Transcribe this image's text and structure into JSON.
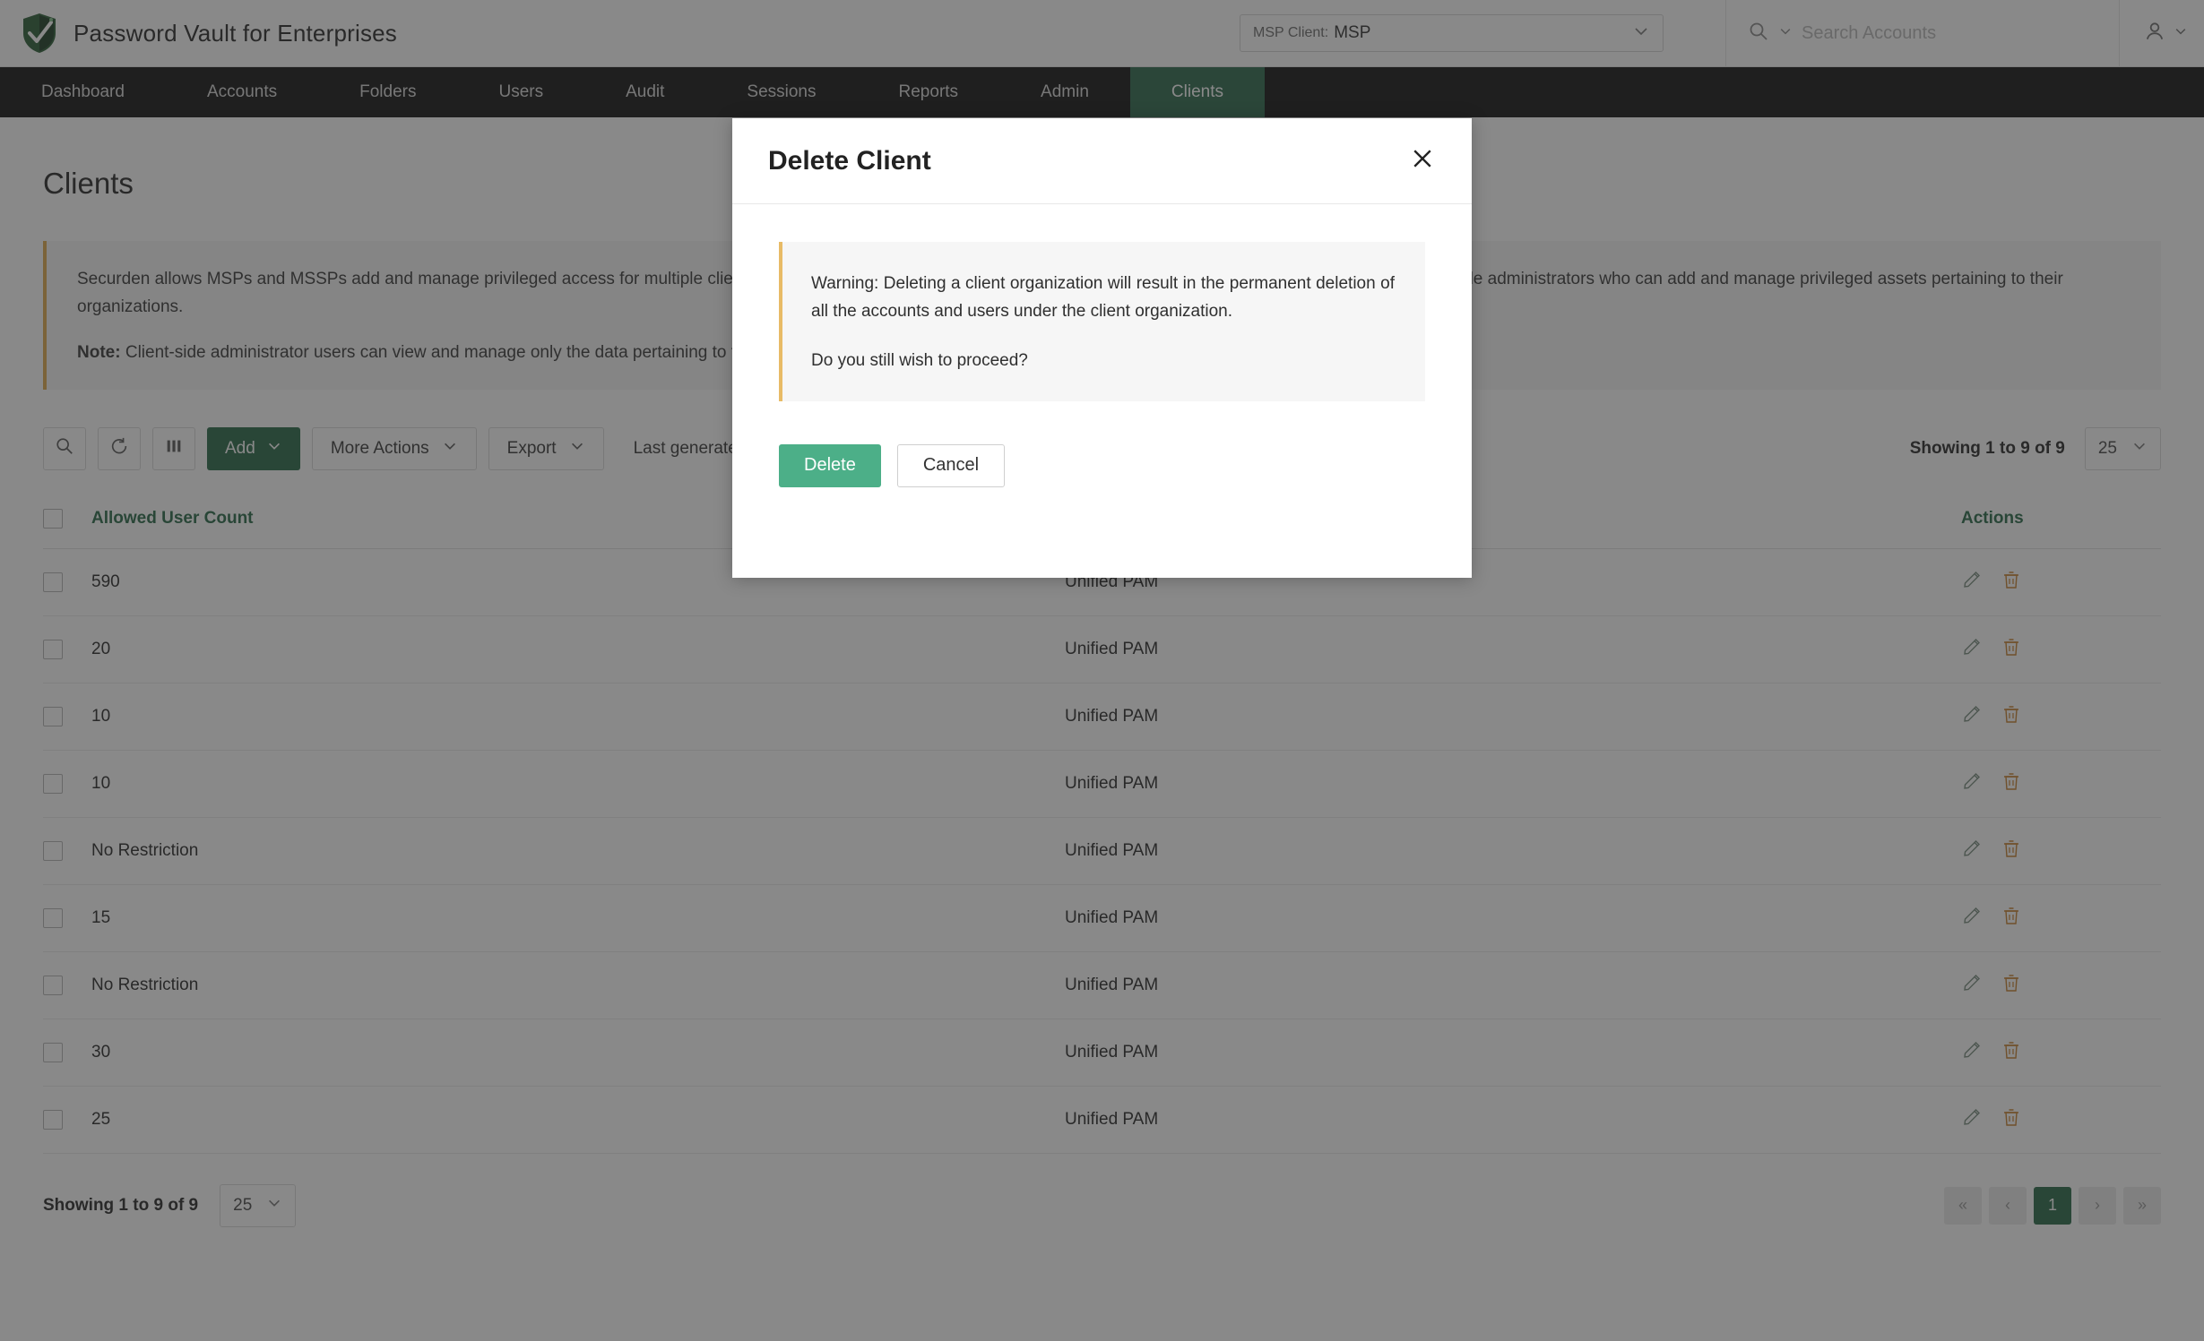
{
  "header": {
    "brand_title": "Password Vault for Enterprises",
    "logo_icon": "shield-check-icon",
    "msp_client_label": "MSP Client:",
    "msp_client_value": "MSP",
    "msp_chevron_icon": "chevron-down-icon",
    "search_icon": "search-icon",
    "search_chevron_icon": "chevron-down-icon",
    "search_placeholder": "Search Accounts",
    "search_value": "",
    "user_icon": "user-icon",
    "user_chevron_icon": "chevron-down-icon"
  },
  "nav": {
    "items": [
      {
        "label": "Dashboard",
        "active": false
      },
      {
        "label": "Accounts",
        "active": false
      },
      {
        "label": "Folders",
        "active": false
      },
      {
        "label": "Users",
        "active": false
      },
      {
        "label": "Audit",
        "active": false
      },
      {
        "label": "Sessions",
        "active": false
      },
      {
        "label": "Reports",
        "active": false
      },
      {
        "label": "Admin",
        "active": false
      },
      {
        "label": "Clients",
        "active": true
      }
    ],
    "active_accent": "#2f6b4f"
  },
  "page": {
    "title": "Clients",
    "info_banner": {
      "paragraph": "Securden allows MSPs and MSSPs add and manage privileged access for multiple clients. You can fully control client privileged access, or opt a co-managed model and assign client-side administrators who can add and manage privileged assets pertaining to their organizations.",
      "note_label": "Note:",
      "note_text": " Client-side administrator users can view and manage only the data pertaining to their own organizations.",
      "accent_color": "#e0aa4f"
    }
  },
  "toolbar": {
    "search_icon": "search-icon",
    "refresh_icon": "refresh-icon",
    "columns_icon": "columns-icon",
    "add_label": "Add",
    "add_chevron_icon": "chevron-down-icon",
    "more_actions_label": "More Actions",
    "more_actions_chevron_icon": "chevron-down-icon",
    "export_label": "Export",
    "export_chevron_icon": "chevron-down-icon",
    "last_generated_text": "Last generated o",
    "showing_text": "Showing 1 to 9 of 9",
    "page_size_value": "25",
    "page_size_chevron_icon": "chevron-down-icon",
    "add_color": "#2b6b4b"
  },
  "table": {
    "columns": {
      "select_all": "select-all-checkbox",
      "allowed_user_count": "Allowed User Count",
      "client_type": "",
      "actions": "Actions"
    },
    "header_color": "#2b6b4b",
    "rows": [
      {
        "allowed_user_count": "590",
        "client_type": "Unified PAM",
        "edit_icon": "pencil-icon",
        "delete_icon": "trash-icon"
      },
      {
        "allowed_user_count": "20",
        "client_type": "Unified PAM",
        "edit_icon": "pencil-icon",
        "delete_icon": "trash-icon"
      },
      {
        "allowed_user_count": "10",
        "client_type": "Unified PAM",
        "edit_icon": "pencil-icon",
        "delete_icon": "trash-icon"
      },
      {
        "allowed_user_count": "10",
        "client_type": "Unified PAM",
        "edit_icon": "pencil-icon",
        "delete_icon": "trash-icon"
      },
      {
        "allowed_user_count": "No Restriction",
        "client_type": "Unified PAM",
        "edit_icon": "pencil-icon",
        "delete_icon": "trash-icon"
      },
      {
        "allowed_user_count": "15",
        "client_type": "Unified PAM",
        "edit_icon": "pencil-icon",
        "delete_icon": "trash-icon"
      },
      {
        "allowed_user_count": "No Restriction",
        "client_type": "Unified PAM",
        "edit_icon": "pencil-icon",
        "delete_icon": "trash-icon"
      },
      {
        "allowed_user_count": "30",
        "client_type": "Unified PAM",
        "edit_icon": "pencil-icon",
        "delete_icon": "trash-icon"
      },
      {
        "allowed_user_count": "25",
        "client_type": "Unified PAM",
        "edit_icon": "pencil-icon",
        "delete_icon": "trash-icon"
      }
    ]
  },
  "footer": {
    "showing_text": "Showing 1 to 9 of 9",
    "page_size_value": "25",
    "page_size_chevron_icon": "chevron-down-icon",
    "pagination": [
      {
        "label": "«",
        "name": "first-page",
        "active": false
      },
      {
        "label": "‹",
        "name": "prev-page",
        "active": false
      },
      {
        "label": "1",
        "name": "page-1",
        "active": true
      },
      {
        "label": "›",
        "name": "next-page",
        "active": false
      },
      {
        "label": "»",
        "name": "last-page",
        "active": false
      }
    ],
    "active_color": "#2b6b4b"
  },
  "modal": {
    "title": "Delete Client",
    "close_icon": "close-icon",
    "warning_paragraph": "Warning: Deleting a client organization will result in the permanent deletion of all the accounts and users under the client organization.",
    "confirm_question": "Do you still wish to proceed?",
    "delete_label": "Delete",
    "cancel_label": "Cancel",
    "delete_color": "#4caf88",
    "warning_accent": "#e8bb66"
  }
}
